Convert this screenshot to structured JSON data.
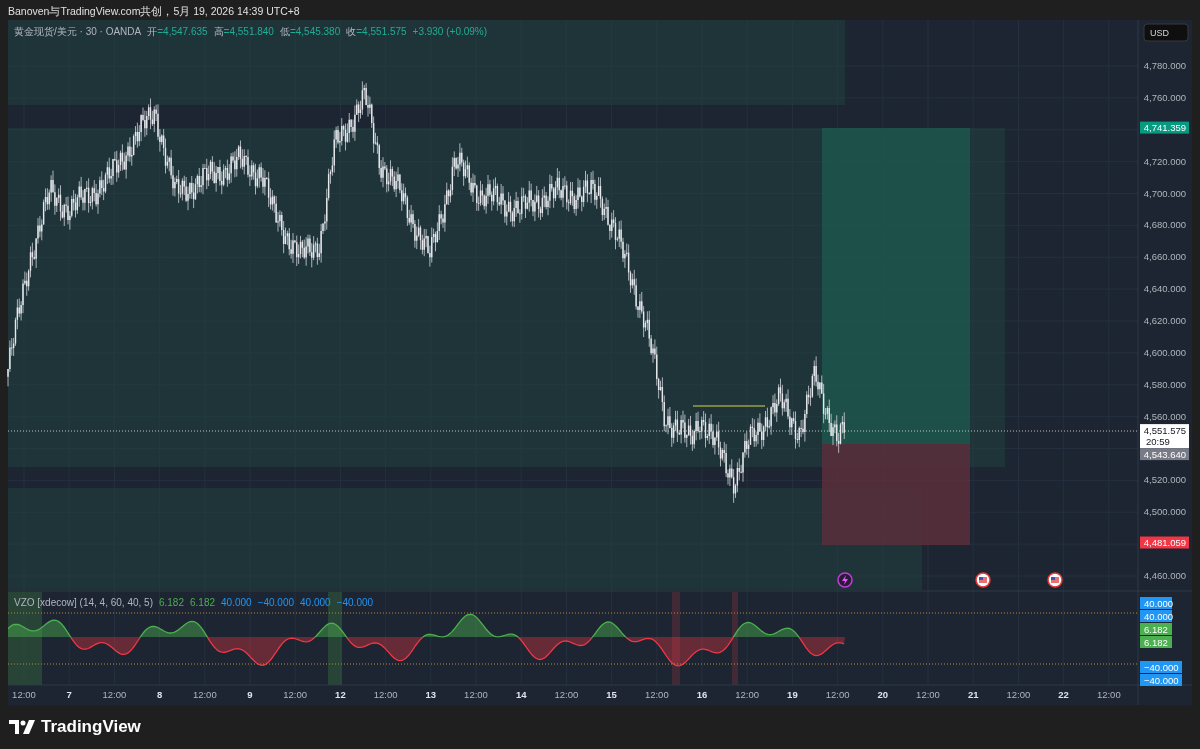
{
  "caption": "Banoven与TradingView.com共创，5月 19, 2026 14:39 UTC+8",
  "legend": {
    "symbol": "黄金现货/美元 · 30 · OANDA",
    "ohlc": [
      {
        "label": "开",
        "value": "=4,547.635"
      },
      {
        "label": "高",
        "value": "=4,551.840"
      },
      {
        "label": "低",
        "value": "=4,545.380"
      },
      {
        "label": "收",
        "value": "=4,551.575"
      }
    ],
    "change": "+3.930 (+0.09%)"
  },
  "currency": "USD",
  "price_axis": [
    "4,780.000",
    "4,760.000",
    "4,720.000",
    "4,700.000",
    "4,680.000",
    "4,660.000",
    "4,640.000",
    "4,620.000",
    "4,600.000",
    "4,580.000",
    "4,560.000",
    "4,520.000",
    "4,500.000",
    "4,460.000"
  ],
  "price_tags": [
    {
      "text": "4,741.359",
      "kind": "target"
    },
    {
      "text": "4,551.575",
      "sub": "20:59",
      "kind": "current"
    },
    {
      "text": "4,543.640",
      "kind": "entry"
    },
    {
      "text": "4,481.059",
      "kind": "stop"
    }
  ],
  "indicator": {
    "title": "VZO [xdecow] (14, 4, 60, 40, 5)",
    "values": [
      {
        "text": "6.182",
        "color": "#4caf50"
      },
      {
        "text": "6.182",
        "color": "#4caf50"
      },
      {
        "text": "40.000",
        "color": "#2196f3"
      },
      {
        "text": "−40.000",
        "color": "#2196f3"
      },
      {
        "text": "40.000",
        "color": "#2196f3"
      },
      {
        "text": "−40.000",
        "color": "#2196f3"
      }
    ]
  },
  "indicator_tags": [
    {
      "text": "40.000",
      "color": "#2196f3"
    },
    {
      "text": "40.000",
      "color": "#2196f3"
    },
    {
      "text": "6.182",
      "color": "#4caf50"
    },
    {
      "text": "6.182",
      "color": "#4caf50"
    },
    {
      "text": "−40.000",
      "color": "#2196f3"
    },
    {
      "text": "−40.000",
      "color": "#2196f3"
    }
  ],
  "time_axis": [
    {
      "label": "12:00",
      "major": false
    },
    {
      "label": "7",
      "major": true
    },
    {
      "label": "12:00",
      "major": false
    },
    {
      "label": "8",
      "major": true
    },
    {
      "label": "12:00",
      "major": false
    },
    {
      "label": "9",
      "major": true
    },
    {
      "label": "12:00",
      "major": false
    },
    {
      "label": "12",
      "major": true
    },
    {
      "label": "12:00",
      "major": false
    },
    {
      "label": "13",
      "major": true
    },
    {
      "label": "12:00",
      "major": false
    },
    {
      "label": "14",
      "major": true
    },
    {
      "label": "12:00",
      "major": false
    },
    {
      "label": "15",
      "major": true
    },
    {
      "label": "12:00",
      "major": false
    },
    {
      "label": "16",
      "major": true
    },
    {
      "label": "12:00",
      "major": false
    },
    {
      "label": "19",
      "major": true
    },
    {
      "label": "12:00",
      "major": false
    },
    {
      "label": "20",
      "major": true
    },
    {
      "label": "12:00",
      "major": false
    },
    {
      "label": "21",
      "major": true
    },
    {
      "label": "12:00",
      "major": false
    },
    {
      "label": "22",
      "major": true
    },
    {
      "label": "12:00",
      "major": false
    }
  ],
  "logo": "TradingView"
}
